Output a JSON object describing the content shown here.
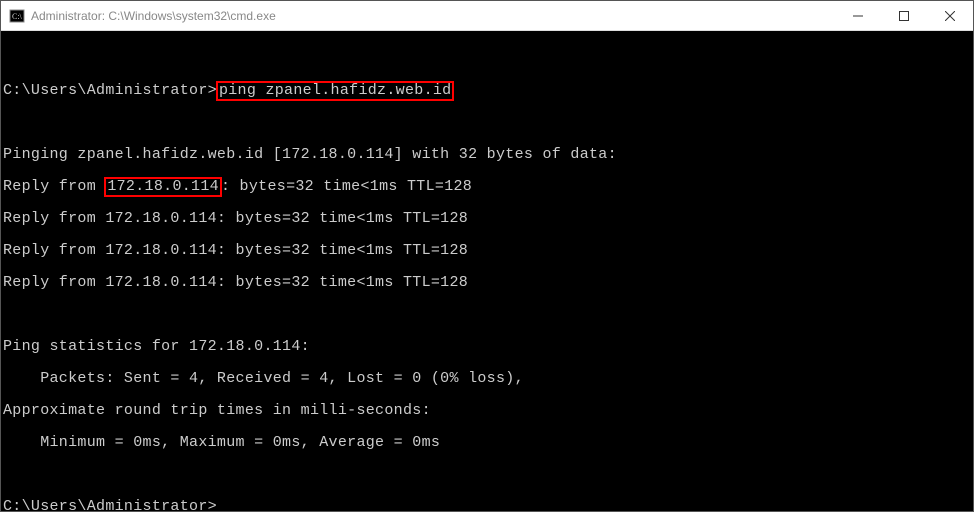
{
  "titlebar": {
    "title": "Administrator: C:\\Windows\\system32\\cmd.exe"
  },
  "term": {
    "prompt1_path": "C:\\Users\\Administrator>",
    "prompt1_cmd": "ping zpanel.hafidz.web.id",
    "pinging": "Pinging zpanel.hafidz.web.id [172.18.0.114] with 32 bytes of data:",
    "reply1_a": "Reply from ",
    "reply1_ip": "172.18.0.114",
    "reply1_b": ": bytes=32 time<1ms TTL=128",
    "reply2": "Reply from 172.18.0.114: bytes=32 time<1ms TTL=128",
    "reply3": "Reply from 172.18.0.114: bytes=32 time<1ms TTL=128",
    "reply4": "Reply from 172.18.0.114: bytes=32 time<1ms TTL=128",
    "stats_header": "Ping statistics for 172.18.0.114:",
    "stats_packets": "    Packets: Sent = 4, Received = 4, Lost = 0 (0% loss),",
    "rtt_header": "Approximate round trip times in milli-seconds:",
    "rtt_values": "    Minimum = 0ms, Maximum = 0ms, Average = 0ms",
    "prompt2_path": "C:\\Users\\Administrator>"
  }
}
